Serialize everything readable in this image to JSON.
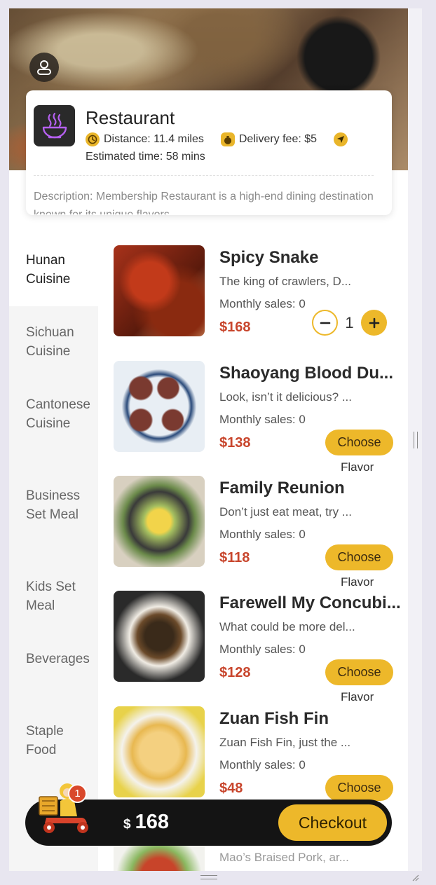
{
  "restaurant": {
    "name": "Restaurant",
    "distance": "Distance: 11.4 miles",
    "delivery_fee": "Delivery fee: $5",
    "estimated_time": "Estimated time: 58 mins",
    "description": "Description: Membership Restaurant is a high-end dining destination known for its unique flavors."
  },
  "categories": [
    {
      "label": "Hunan Cuisine",
      "active": true
    },
    {
      "label": "Sichuan Cuisine",
      "active": false
    },
    {
      "label": "Cantonese Cuisine",
      "active": false
    },
    {
      "label": "Business Set Meal",
      "active": false
    },
    {
      "label": "Kids Set Meal",
      "active": false
    },
    {
      "label": "Beverages",
      "active": false
    },
    {
      "label": "Staple Food",
      "active": false
    }
  ],
  "dishes": [
    {
      "name": "Spicy Snake",
      "desc": "The king of crawlers, D...",
      "sales": "Monthly sales: 0",
      "price": "$168",
      "action": "stepper",
      "quantity": "1"
    },
    {
      "name": "Shaoyang Blood Du...",
      "desc": "Look, isn’t it delicious? ...",
      "sales": "Monthly sales: 0",
      "price": "$138",
      "action": "choose"
    },
    {
      "name": "Family Reunion",
      "desc": "Don’t just eat meat, try ...",
      "sales": "Monthly sales: 0",
      "price": "$118",
      "action": "choose"
    },
    {
      "name": "Farewell My Concubi...",
      "desc": "What could be more del...",
      "sales": "Monthly sales: 0",
      "price": "$128",
      "action": "choose"
    },
    {
      "name": "Zuan Fish Fin",
      "desc": "Zuan Fish Fin, just the ...",
      "sales": "Monthly sales: 0",
      "price": "$48",
      "action": "choose"
    },
    {
      "name": "",
      "desc": "Mao’s Braised Pork, ar...",
      "sales": "",
      "price": "",
      "action": "none"
    }
  ],
  "choose_label": "Choose",
  "flavor_label": "Flavor",
  "cart": {
    "badge_count": "1",
    "currency": "$",
    "total": "168",
    "checkout_label": "Checkout"
  },
  "colors": {
    "accent": "#edb82a",
    "price": "#c8452c",
    "cart_bar": "#141414",
    "badge": "#d9482b"
  },
  "icons": {
    "avatar": "user-icon",
    "logo": "bowl-icon",
    "distance": "clock-icon",
    "fee": "money-bag-icon",
    "location": "navigation-icon",
    "cart": "courier-scooter-icon"
  }
}
